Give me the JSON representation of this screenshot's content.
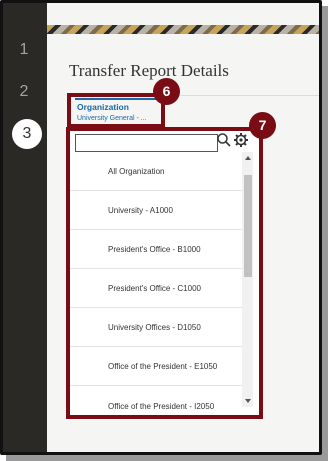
{
  "steps": [
    "1",
    "2",
    "3"
  ],
  "page": {
    "title": "Transfer Report Details"
  },
  "tab": {
    "label": "Organization",
    "value": "University General - ..."
  },
  "callouts": {
    "tab_badge": "6",
    "list_badge": "7"
  },
  "search": {
    "value": "",
    "placeholder": ""
  },
  "icons": {
    "search": "search-icon",
    "settings": "gear-icon"
  },
  "organizations": [
    "All Organization",
    "University - A1000",
    "President's Office - B1000",
    "President's Office - C1000",
    "University Offices - D1050",
    "Office of the President - E1050",
    "Office of the President - I2050"
  ],
  "colors": {
    "accent": "#1a6aa8",
    "callout": "#7a0c16",
    "rail": "#2b2926"
  }
}
